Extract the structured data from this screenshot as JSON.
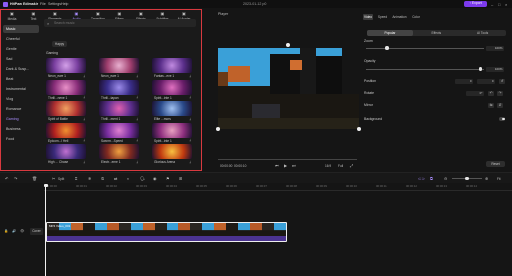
{
  "app": {
    "name": "HitPaw Edimakir",
    "project_title": "2023-01-12 p0",
    "export_label": "Export"
  },
  "menu": [
    "File",
    "Settings",
    "Help"
  ],
  "left_tabs": [
    {
      "label": "Media",
      "icon": "folder-icon",
      "active": false
    },
    {
      "label": "Text",
      "icon": "text-icon",
      "active": false
    },
    {
      "label": "Elements",
      "icon": "elements-icon",
      "active": false
    },
    {
      "label": "Audio",
      "icon": "music-note-icon",
      "active": true
    },
    {
      "label": "Transition",
      "icon": "transition-icon",
      "active": false
    },
    {
      "label": "Filters",
      "icon": "filters-icon",
      "active": false
    },
    {
      "label": "Effects",
      "icon": "effects-icon",
      "active": false
    },
    {
      "label": "Subtitles",
      "icon": "subtitles-icon",
      "active": false
    },
    {
      "label": "AI Avatar",
      "icon": "avatar-icon",
      "active": false
    }
  ],
  "categories": [
    {
      "label": "Music",
      "state": "selected"
    },
    {
      "label": "Cheerful",
      "state": "normal"
    },
    {
      "label": "Gentle",
      "state": "normal"
    },
    {
      "label": "Sad",
      "state": "normal"
    },
    {
      "label": "Dark & Susp...",
      "state": "normal"
    },
    {
      "label": "Beat",
      "state": "normal"
    },
    {
      "label": "Instrumental",
      "state": "normal"
    },
    {
      "label": "Vlog",
      "state": "normal"
    },
    {
      "label": "Romance",
      "state": "normal"
    },
    {
      "label": "Gaming",
      "state": "highlight"
    },
    {
      "label": "Business",
      "state": "normal"
    },
    {
      "label": "Food",
      "state": "normal"
    }
  ],
  "search": {
    "placeholder": "Search music"
  },
  "chip_label": "Happy",
  "section_title": "Gaming",
  "music_tiles": [
    {
      "name": "Neon_ewe 1",
      "colors": [
        "#7a3fa0",
        "#d3a0e8"
      ]
    },
    {
      "name": "Neon_ewe 1",
      "colors": [
        "#a03f6e",
        "#e8b0d0"
      ]
    },
    {
      "name": "Fantas...eve 1",
      "colors": [
        "#5a2e8a",
        "#c08ae0"
      ]
    },
    {
      "name": "Thrill...nene 1",
      "colors": [
        "#8a2e7a",
        "#e890c8"
      ]
    },
    {
      "name": "Thrill...tapan",
      "colors": [
        "#3a2e8a",
        "#9a8ae8"
      ]
    },
    {
      "name": "Spirit...inte 1",
      "colors": [
        "#6a1e6a",
        "#e070c0"
      ]
    },
    {
      "name": "Spirit of Battle",
      "colors": [
        "#b03030",
        "#f0a060"
      ]
    },
    {
      "name": "Thrill...ment 1",
      "colors": [
        "#603090",
        "#e060b0"
      ]
    },
    {
      "name": "Elite ...mors",
      "colors": [
        "#2a4a8a",
        "#a0c0f0"
      ]
    },
    {
      "name": "Epicom...l Hell",
      "colors": [
        "#b02020",
        "#f09030"
      ]
    },
    {
      "name": "Sworm...Speed",
      "colors": [
        "#7a2ea0",
        "#e080d0"
      ]
    },
    {
      "name": "Spirit...inte 1",
      "colors": [
        "#903080",
        "#e8a0c0"
      ]
    },
    {
      "name": "High ... Chase",
      "colors": [
        "#3a2a7a",
        "#c070d0"
      ]
    },
    {
      "name": "Electr...eme 1",
      "colors": [
        "#802a20",
        "#f0a040"
      ]
    },
    {
      "name": "Glorious Arena",
      "colors": [
        "#c03a10",
        "#f8c040"
      ]
    }
  ],
  "player": {
    "header": "Player",
    "current_time": "00:00:00",
    "total_time": "00:00:10",
    "ratio": "16:9",
    "quality": "Full"
  },
  "right_panel": {
    "tabs": [
      {
        "label": "Video",
        "selected": true
      },
      {
        "label": "Speed",
        "selected": false
      },
      {
        "label": "Animation",
        "selected": false
      },
      {
        "label": "Color",
        "selected": false
      }
    ],
    "segments": [
      {
        "label": "Popular",
        "selected": true
      },
      {
        "label": "Effects",
        "selected": false
      },
      {
        "label": "AI Tools",
        "selected": false
      }
    ],
    "zoom": {
      "label": "Zoom",
      "value": "100%",
      "fraction": 0.18
    },
    "opacity": {
      "label": "Opacity",
      "value": "100%",
      "fraction": 0.97
    },
    "position": {
      "label": "Position",
      "x": "0",
      "y": "0"
    },
    "rotate": {
      "label": "Rotate",
      "value": "0°"
    },
    "mirror": {
      "label": "Mirror"
    },
    "background": {
      "label": "Background"
    },
    "reset_label": "Reset"
  },
  "toolbar": {
    "split_label": "Split",
    "zoom_fit": "Fit",
    "icons": [
      "undo-icon",
      "redo-icon",
      "delete-icon",
      "split-icon",
      "crop-icon",
      "freeze-icon",
      "speed-icon",
      "reverse-icon",
      "record-icon"
    ]
  },
  "ruler_ticks": [
    "00:00:00",
    "00:00:01",
    "00:00:02",
    "00:00:03",
    "00:00:04",
    "00:00:05",
    "00:00:06",
    "00:00:07",
    "00:00:08",
    "00:00:09",
    "00:00:10",
    "00:00:11",
    "00:00:12",
    "00:00:13",
    "00:00:14"
  ],
  "timeline": {
    "cover_label": "Cover",
    "clip_title": "MP4 Video_001"
  }
}
